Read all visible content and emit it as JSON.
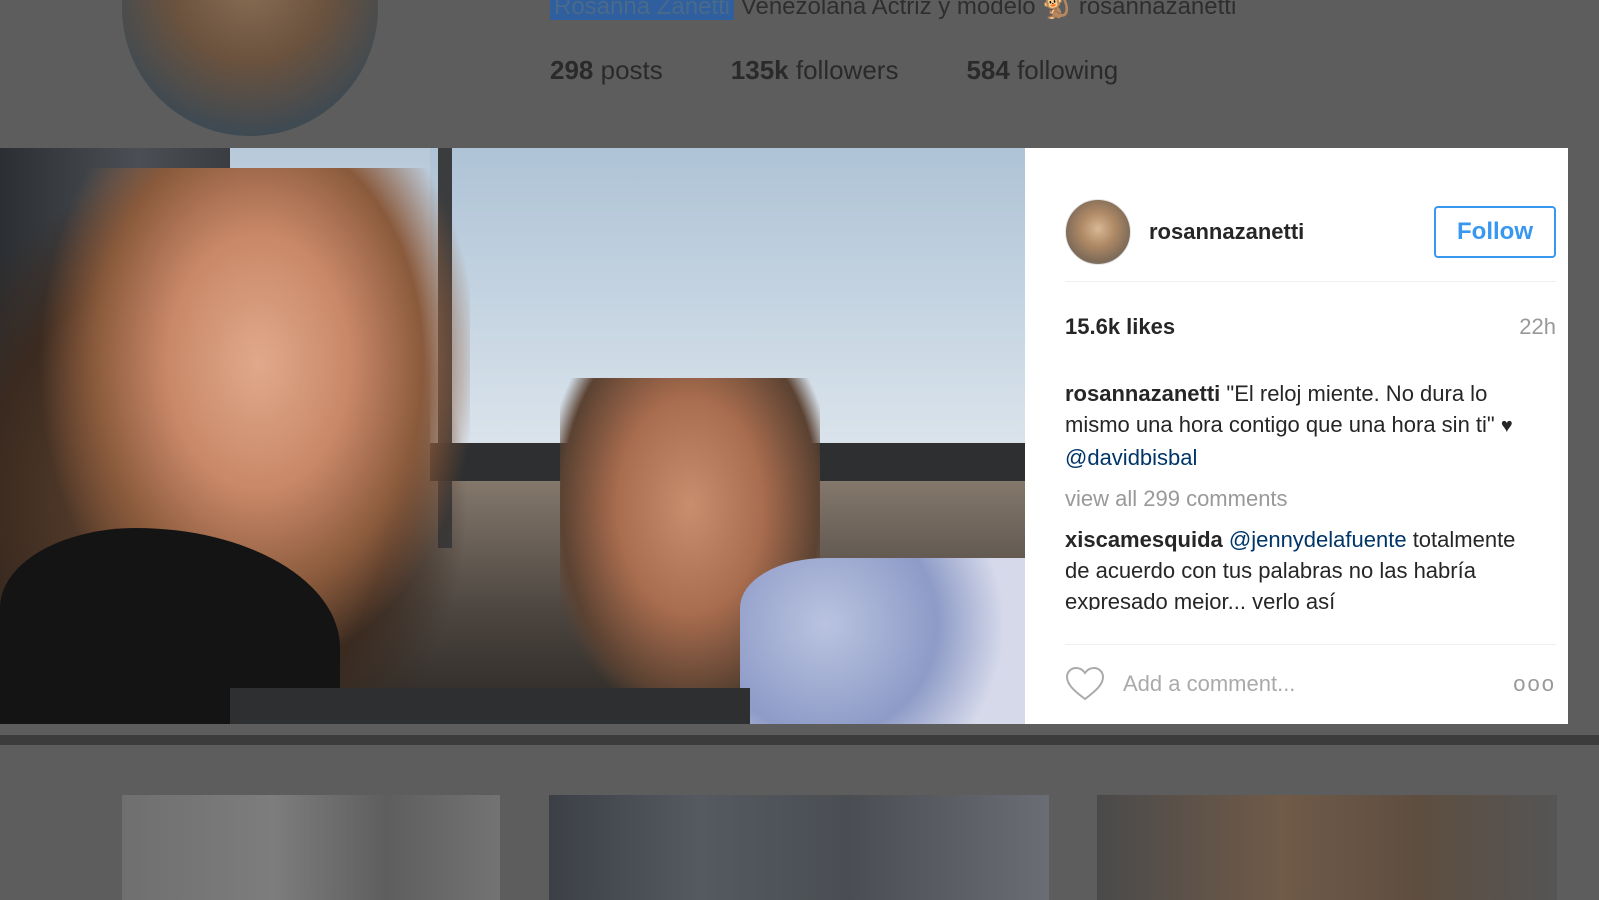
{
  "profile_header": {
    "name": "Rosanna Zanetti",
    "bio": "Venezolana Actriz y modelo 🐒 rosannazanetti",
    "stats": [
      {
        "count": "298",
        "label": "posts"
      },
      {
        "count": "135k",
        "label": "followers"
      },
      {
        "count": "584",
        "label": "following"
      }
    ]
  },
  "post": {
    "username": "rosannazanetti",
    "follow_label": "Follow",
    "likes": "15.6k likes",
    "time": "22h",
    "caption_user": "rosannazanetti",
    "caption_text": " \"El reloj miente. No dura lo mismo una hora contigo que una hora sin ti\" ",
    "caption_heart": "♥",
    "caption_mention": "@davidbisbal",
    "view_all": "view all 299 comments",
    "comment_user": "xiscamesquida",
    "comment_mention": "@jennydelafuente",
    "comment_text": "totalmente de acuerdo con tus palabras no las habría expresado mejor... verlo así",
    "add_comment_placeholder": "Add a comment...",
    "more_glyph": "ooo"
  },
  "colors": {
    "accent": "#3897f0",
    "mention": "#003569",
    "muted": "#999999",
    "overlay": "#5d5d5d"
  },
  "icons": {
    "like": "heart-icon",
    "more": "more-options-icon"
  }
}
